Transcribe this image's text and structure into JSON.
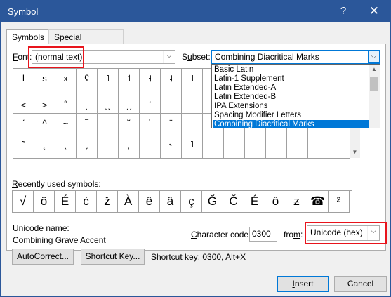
{
  "window": {
    "title": "Symbol",
    "help": "?",
    "close": "✕"
  },
  "tabs": [
    {
      "label_pre": "",
      "label_ul": "S",
      "label_post": "ymbols"
    },
    {
      "label_pre": "",
      "label_ul": "S",
      "label_post": "pecial Characters"
    }
  ],
  "font": {
    "label_pre": "",
    "label_ul": "F",
    "label_post": "ont:",
    "value": "(normal text)"
  },
  "subset": {
    "label_pre": "S",
    "label_ul": "u",
    "label_post": "bset:",
    "value": "Combining Diacritical Marks"
  },
  "subset_options": [
    "Basic Latin",
    "Latin-1 Supplement",
    "Latin Extended-A",
    "Latin Extended-B",
    "IPA Extensions",
    "Spacing Modifier Letters",
    "Combining Diacritical Marks"
  ],
  "symbol_grid": [
    [
      "l",
      "s",
      "x",
      "ʕ",
      "˥",
      "˦",
      "˧",
      "˨",
      "˩",
      "",
      "",
      "",
      "",
      "",
      "",
      ""
    ],
    [
      "˂",
      "˃",
      "˚",
      "ˎ",
      "ˎˎ",
      "ˏˏ",
      "ˊ",
      "ˌ",
      "",
      "",
      "",
      "",
      "",
      "",
      "",
      ""
    ],
    [
      "ˊ",
      "^",
      "~",
      "‾",
      "—",
      "˘",
      "˙",
      "¨",
      "",
      "",
      "",
      "",
      "",
      "",
      "",
      ""
    ],
    [
      "˜",
      "˛",
      "ˎ",
      "ˏ",
      "",
      "ˌ",
      "",
      "˞",
      "˥",
      "",
      "",
      "",
      "",
      "",
      "",
      ""
    ]
  ],
  "recent": {
    "label_pre": "",
    "label_ul": "R",
    "label_post": "ecently used symbols:",
    "symbols": [
      "√",
      "ö",
      "É",
      "ć",
      "ž",
      "À",
      "ê",
      "â",
      "ç",
      "Ğ",
      "Č",
      "É",
      "ô",
      "ƶ",
      "☎",
      "²"
    ]
  },
  "unicode_name_label": "Unicode name:",
  "unicode_name_value": "Combining Grave Accent",
  "char_code": {
    "label_pre": "",
    "label_ul": "C",
    "label_post": "haracter code:",
    "value": "0300"
  },
  "from": {
    "label_pre": "fro",
    "label_ul": "m",
    "label_post": ":",
    "value": "Unicode (hex)"
  },
  "buttons": {
    "autocorrect_pre": "",
    "autocorrect_ul": "A",
    "autocorrect_post": "utoCorrect...",
    "shortcut_pre": "Shortcut ",
    "shortcut_ul": "K",
    "shortcut_post": "ey...",
    "insert_pre": "",
    "insert_ul": "I",
    "insert_post": "nsert",
    "cancel": "Cancel"
  },
  "shortcut_info": "Shortcut key: 0300, Alt+X",
  "colors": {
    "title_bar": "#2b579a",
    "highlight": "#0078d7",
    "annotation": "#e8141c"
  }
}
